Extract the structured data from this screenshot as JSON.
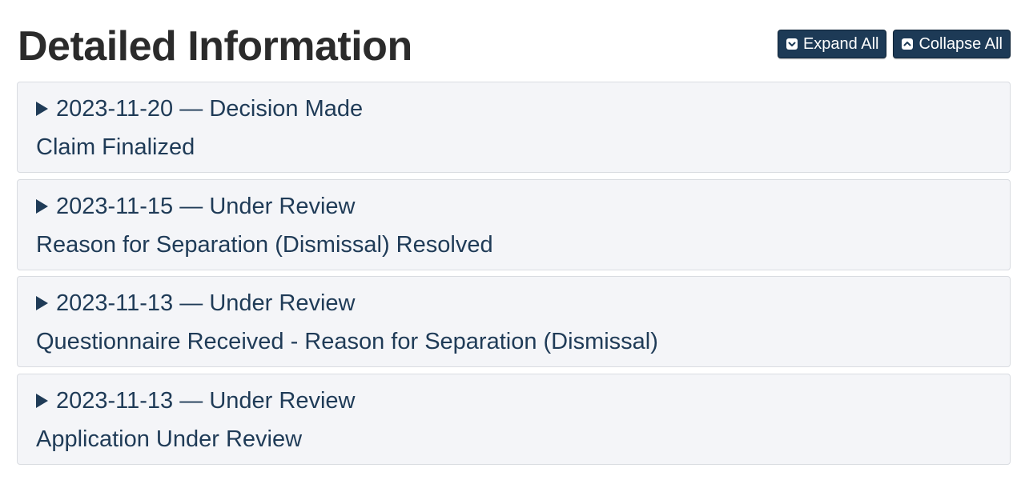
{
  "page": {
    "title": "Detailed Information"
  },
  "toolbar": {
    "expand_label": "Expand All",
    "collapse_label": "Collapse All",
    "expand_icon": "chevron-down-box-icon",
    "collapse_icon": "chevron-up-box-icon"
  },
  "events": [
    {
      "date": "2023-11-20",
      "separator": "—",
      "status": "Decision Made",
      "description": "Claim Finalized"
    },
    {
      "date": "2023-11-15",
      "separator": "—",
      "status": "Under Review",
      "description": "Reason for Separation (Dismissal) Resolved"
    },
    {
      "date": "2023-11-13",
      "separator": "—",
      "status": "Under Review",
      "description": "Questionnaire Received - Reason for Separation (Dismissal)"
    },
    {
      "date": "2023-11-13",
      "separator": "—",
      "status": "Under Review",
      "description": "Application Under Review"
    }
  ],
  "colors": {
    "text": "#1f3b57",
    "title": "#2b2b2b",
    "button_bg": "#1d3a56",
    "item_bg": "#f4f5f8",
    "item_border": "#d9dce1"
  }
}
